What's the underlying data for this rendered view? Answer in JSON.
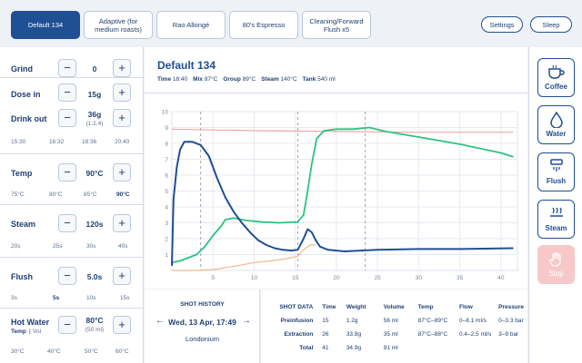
{
  "tabs": [
    {
      "label": "Default 134",
      "active": true
    },
    {
      "label": "Adaptive (for medium roasts)",
      "active": false
    },
    {
      "label": "Rao Allongé",
      "active": false
    },
    {
      "label": "80's Espresso",
      "active": false
    },
    {
      "label": "Cleaning/Forward Flush x5",
      "active": false
    }
  ],
  "header": {
    "settings_label": "Settings",
    "sleep_label": "Sleep"
  },
  "controls": {
    "grind": {
      "label": "Grind",
      "value": "0"
    },
    "dose": {
      "label": "Dose in",
      "value": "15g"
    },
    "drink": {
      "label": "Drink out",
      "value": "36g",
      "sub": "(1:2.4)",
      "presets": [
        "15:30",
        "16:32",
        "18:36",
        "20:40"
      ]
    },
    "temp": {
      "label": "Temp",
      "value": "90°C",
      "presets": [
        "75°C",
        "80°C",
        "85°C",
        "90°C"
      ],
      "selected": 3
    },
    "steam": {
      "label": "Steam",
      "value": "120s",
      "presets": [
        "20s",
        "25s",
        "30s",
        "40s"
      ]
    },
    "flush": {
      "label": "Flush",
      "value": "5.0s",
      "presets": [
        "3s",
        "5s",
        "10s",
        "15s"
      ],
      "selected": 1
    },
    "hotwater": {
      "label": "Hot Water",
      "sub_label_a": "Temp",
      "sub_label_b": "Vol",
      "value": "80°C",
      "sub": "(50 ml)",
      "presets": [
        "30°C",
        "40°C",
        "50°C",
        "60°C"
      ]
    }
  },
  "profile": {
    "title": "Default 134",
    "stats": [
      {
        "k": "Time",
        "v": "18:40"
      },
      {
        "k": "Mix",
        "v": "87°C"
      },
      {
        "k": "Group",
        "v": "89°C"
      },
      {
        "k": "Steam",
        "v": "140°C"
      },
      {
        "k": "Tank",
        "v": "540 ml"
      }
    ]
  },
  "actions": [
    {
      "label": "Coffee",
      "icon": "coffee-cup-icon"
    },
    {
      "label": "Water",
      "icon": "water-drop-icon"
    },
    {
      "label": "Flush",
      "icon": "flush-icon"
    },
    {
      "label": "Steam",
      "icon": "steam-icon"
    },
    {
      "label": "Stop",
      "icon": "hand-stop-icon"
    }
  ],
  "history": {
    "title": "SHOT HISTORY",
    "date": "Wed, 13 Apr, 17:49",
    "name": "Londonium"
  },
  "shot_data": {
    "headers": [
      "SHOT DATA",
      "Time",
      "Weight",
      "Volume",
      "Temp",
      "Flow",
      "Pressure"
    ],
    "rows": [
      [
        "Preinfusion",
        "15",
        "1.2g",
        "56 ml",
        "87°C–89°C",
        "0–8.1 ml/s",
        "0–3.3 bar"
      ],
      [
        "Extraction",
        "26",
        "33.8g",
        "35 ml",
        "87°C–88°C",
        "0.4–2.5 ml/s",
        "3–9 bar"
      ],
      [
        "Total",
        "41",
        "34.9g",
        "91 ml",
        "",
        "",
        ""
      ]
    ]
  },
  "colors": {
    "accent": "#1f4f94",
    "pressure": "#1f4f94",
    "flow": "#2ec27e",
    "temp": "#f4a6a6",
    "weight": "#f0b78e",
    "stop": "#f8c8c8"
  },
  "chart_data": {
    "type": "line",
    "xlim": [
      0,
      42
    ],
    "ylim": [
      0,
      10
    ],
    "x_ticks": [
      5,
      10,
      15,
      20,
      25,
      30,
      35,
      40
    ],
    "y_ticks": [
      1,
      2,
      3,
      4,
      5,
      6,
      7,
      8,
      9,
      10
    ],
    "grid": true,
    "phase_markers_x": [
      3.5,
      15.3,
      23.5
    ],
    "series": [
      {
        "key": "pressure",
        "points": [
          [
            0,
            0.3
          ],
          [
            0.2,
            4.5
          ],
          [
            0.6,
            6.5
          ],
          [
            1,
            7.6
          ],
          [
            1.5,
            8.1
          ],
          [
            2.5,
            8.1
          ],
          [
            3.5,
            7.9
          ],
          [
            4.5,
            7.2
          ],
          [
            5.5,
            5.8
          ],
          [
            6.5,
            4.6
          ],
          [
            7.5,
            3.7
          ],
          [
            8.5,
            3.0
          ],
          [
            9.5,
            2.4
          ],
          [
            10.5,
            1.9
          ],
          [
            11.5,
            1.6
          ],
          [
            12.5,
            1.4
          ],
          [
            13.5,
            1.3
          ],
          [
            14.5,
            1.25
          ],
          [
            15.3,
            1.3
          ],
          [
            16,
            2.0
          ],
          [
            16.5,
            2.6
          ],
          [
            17,
            2.4
          ],
          [
            17.5,
            1.9
          ],
          [
            18,
            1.5
          ],
          [
            19,
            1.3
          ],
          [
            21,
            1.2
          ],
          [
            25,
            1.3
          ],
          [
            30,
            1.35
          ],
          [
            35,
            1.35
          ],
          [
            41.5,
            1.4
          ]
        ]
      },
      {
        "key": "flow",
        "points": [
          [
            0,
            0.5
          ],
          [
            1,
            0.6
          ],
          [
            2,
            0.8
          ],
          [
            3,
            1.0
          ],
          [
            4,
            1.5
          ],
          [
            5,
            2.2
          ],
          [
            6,
            2.8
          ],
          [
            6.5,
            3.2
          ],
          [
            7.5,
            3.3
          ],
          [
            9,
            3.15
          ],
          [
            11,
            3.05
          ],
          [
            13,
            3.0
          ],
          [
            15.3,
            3.05
          ],
          [
            16,
            3.5
          ],
          [
            16.5,
            5.0
          ],
          [
            17,
            6.7
          ],
          [
            17.6,
            8.3
          ],
          [
            18.5,
            8.8
          ],
          [
            20,
            8.9
          ],
          [
            22,
            8.9
          ],
          [
            24,
            9.0
          ],
          [
            26,
            8.75
          ],
          [
            30,
            8.4
          ],
          [
            35,
            7.95
          ],
          [
            40,
            7.4
          ],
          [
            41.5,
            7.15
          ]
        ]
      },
      {
        "key": "temp",
        "points": [
          [
            0,
            8.9
          ],
          [
            10,
            8.8
          ],
          [
            20,
            8.75
          ],
          [
            30,
            8.7
          ],
          [
            41.5,
            8.7
          ]
        ]
      },
      {
        "key": "weight",
        "points": [
          [
            0,
            0
          ],
          [
            3,
            0
          ],
          [
            5,
            0.05
          ],
          [
            8,
            0.3
          ],
          [
            10,
            0.5
          ],
          [
            12,
            0.6
          ],
          [
            14,
            0.75
          ],
          [
            15.3,
            0.9
          ],
          [
            16,
            1.3
          ],
          [
            16.8,
            1.6
          ],
          [
            17.5,
            1.6
          ]
        ]
      }
    ]
  }
}
